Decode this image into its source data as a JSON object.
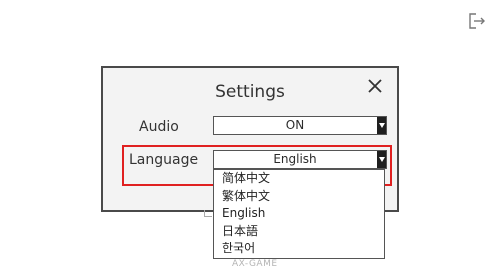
{
  "settings": {
    "title": "Settings",
    "audio_label": "Audio",
    "audio_value": "ON",
    "language_label": "Language",
    "language_value": "English",
    "language_options": [
      "简体中文",
      "繁体中文",
      "English",
      "日本語",
      "한국어"
    ]
  },
  "footer": {
    "text": "AX-GAME"
  },
  "icons": {
    "exit": "exit-icon",
    "close": "close-icon",
    "dropdown": "chevron-down-icon"
  },
  "colors": {
    "highlight": "#e02020",
    "dialog_bg": "#f3f3f3",
    "border": "#4a4a4a"
  }
}
